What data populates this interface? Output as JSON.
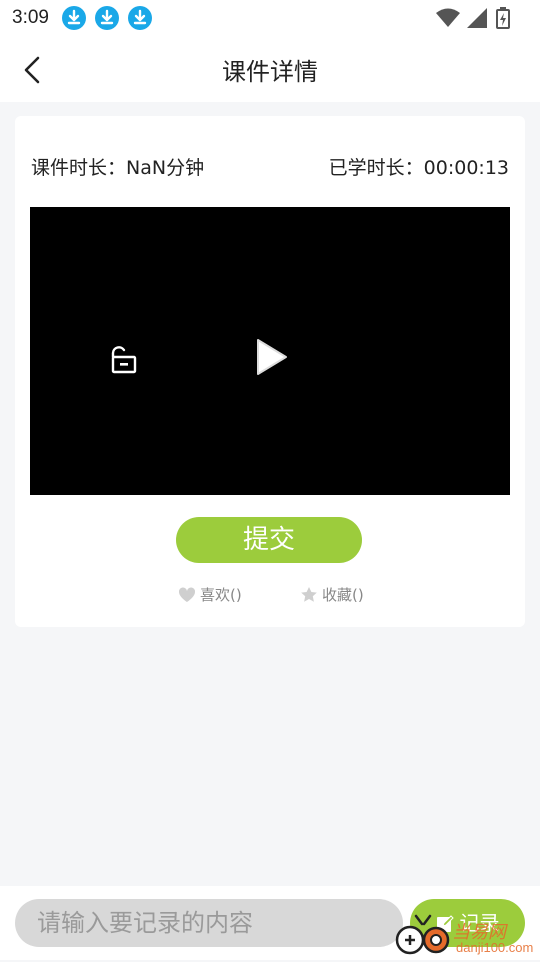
{
  "status_bar": {
    "time": "3:09",
    "notification_icons": [
      "download-icon",
      "download-icon",
      "download-icon"
    ],
    "system_icons": [
      "wifi-icon",
      "signal-icon",
      "battery-charging-icon"
    ]
  },
  "nav": {
    "back_icon": "chevron-left-icon",
    "title": "课件详情"
  },
  "course": {
    "duration_label": "课件时长：NaN分钟",
    "studied_label": "已学时长：00:00:13"
  },
  "video": {
    "lock_icon": "unlock-icon",
    "play_icon": "play-icon"
  },
  "actions": {
    "submit_label": "提交",
    "like_label": "喜欢()",
    "favorite_label": "收藏()"
  },
  "bottom": {
    "input_placeholder": "请输入要记录的内容",
    "input_value": "",
    "record_label": "记录"
  },
  "watermark": {
    "text": "当易网",
    "sub": "danji100.com"
  },
  "colors": {
    "accent": "#9ccc3c",
    "notification_blue": "#1aa8e8",
    "background": "#f5f6f8"
  }
}
